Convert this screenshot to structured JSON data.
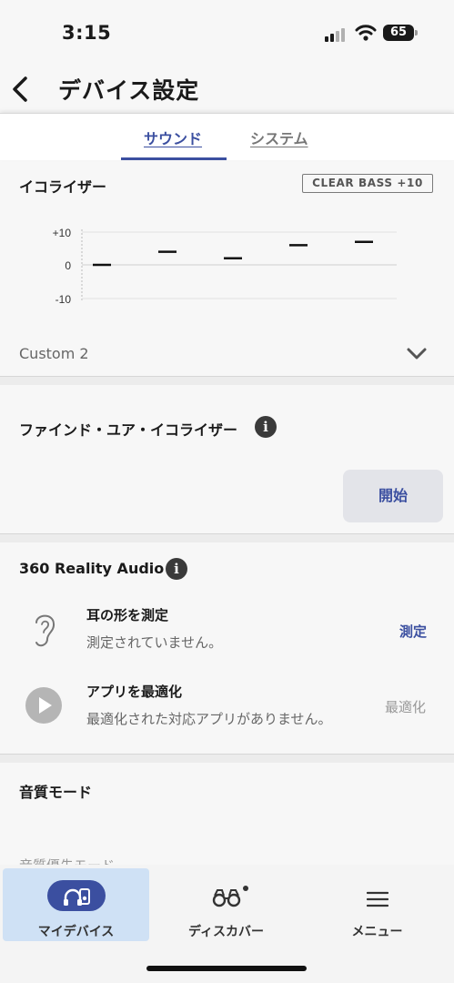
{
  "status_bar": {
    "time": "3:15",
    "battery": "65"
  },
  "header": {
    "title": "デバイス設定"
  },
  "tabs": [
    {
      "label": "サウンド",
      "active": true
    },
    {
      "label": "システム",
      "active": false
    }
  ],
  "equalizer": {
    "title": "イコライザー",
    "badge": "CLEAR BASS +10",
    "y_ticks": [
      "+10",
      "0",
      "-10"
    ],
    "band_values": [
      0,
      4,
      2,
      6,
      7
    ],
    "preset": "Custom 2"
  },
  "find_your_eq": {
    "title": "ファインド・ユア・イコライザー",
    "button_label": "開始"
  },
  "reality_audio": {
    "title": "360 Reality Audio",
    "ear": {
      "title": "耳の形を測定",
      "subtitle": "測定されていません。",
      "action": "測定"
    },
    "app": {
      "title": "アプリを最適化",
      "subtitle": "最適化された対応アプリがありません。",
      "action": "最適化"
    }
  },
  "sound_quality": {
    "title": "音質モード",
    "peek_text": "音質優先モード"
  },
  "bottom_nav": [
    {
      "label": "マイデバイス",
      "active": true
    },
    {
      "label": "ディスカバー",
      "active": false
    },
    {
      "label": "メニュー",
      "active": false
    }
  ],
  "colors": {
    "accent": "#3b4fa0",
    "active_nav_bg": "#cfe1f5",
    "button_bg": "#e3e4e9"
  }
}
